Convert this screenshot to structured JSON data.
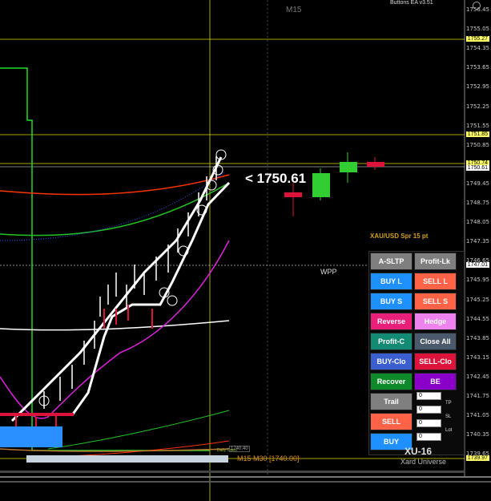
{
  "header": {
    "ea_title": "Buttons EA  v3.51",
    "timeframe": "M15"
  },
  "price_axis": {
    "labels": [
      "1756.45",
      "1755.05",
      "1754.35",
      "1753.65",
      "1752.95",
      "1752.25",
      "1751.55",
      "1750.85",
      "1750.15",
      "1749.45",
      "1748.75",
      "1748.05",
      "1747.35",
      "1746.65",
      "1745.95",
      "1745.25",
      "1744.55",
      "1743.85",
      "1743.15",
      "1742.45",
      "1741.75",
      "1741.05",
      "1740.35",
      "1739.65"
    ],
    "highlight_levels": [
      {
        "label": "1755.27",
        "color": "#ffff66"
      },
      {
        "label": "1751.85",
        "color": "#ffff66"
      },
      {
        "label": "1750.74",
        "color": "#ffff66"
      },
      {
        "label": "1750.61",
        "color": "#ffffff"
      },
      {
        "label": "1747.01",
        "color": "#ffffff"
      },
      {
        "label": "1739.97",
        "color": "#ffff66"
      }
    ]
  },
  "overlay": {
    "current_price": "<  1750.61",
    "symbol_spread": "XAU/USD Spr 15 pt",
    "wpp_label": "WPP",
    "period_label": "M15 M30  [1740.00]",
    "daily_label": "Daily Open",
    "low_box": "1740.40"
  },
  "panel": {
    "buttons": [
      {
        "label": "A-SLTP",
        "color": "#7f7f7f"
      },
      {
        "label": "Profit-Lk",
        "color": "#7f7f7f"
      },
      {
        "label": "BUY L",
        "color": "#1e90ff"
      },
      {
        "label": "SELL L",
        "color": "#ff6347"
      },
      {
        "label": "BUY S",
        "color": "#1e90ff"
      },
      {
        "label": "SELL S",
        "color": "#ff6347"
      },
      {
        "label": "Reverse",
        "color": "#e8207a"
      },
      {
        "label": "Hedge",
        "color": "#ee82ee"
      },
      {
        "label": "Profit-C",
        "color": "#138a73"
      },
      {
        "label": "Close All",
        "color": "#4a5a6a"
      },
      {
        "label": "BUY-Clo",
        "color": "#3b5fcf"
      },
      {
        "label": "SELL-Clo",
        "color": "#dc143c"
      },
      {
        "label": "Recover",
        "color": "#0f8a2a"
      },
      {
        "label": "BE",
        "color": "#8b00c8"
      },
      {
        "label": "Trail",
        "color": "#7f7f7f"
      },
      {
        "label": "SELL",
        "color": "#ff6347"
      },
      {
        "label": "BUY",
        "color": "#1e90ff"
      }
    ],
    "inputs": [
      {
        "value": "0",
        "label": ""
      },
      {
        "value": "0",
        "label": "TP"
      },
      {
        "value": "0",
        "label": "SL"
      },
      {
        "value": "0",
        "label": "Lot"
      }
    ]
  },
  "branding": {
    "xu": "XU-16",
    "xard": "Xard Universe"
  },
  "colors": {
    "background": "#000000",
    "bull": "#32cd32",
    "bear": "#dc143c",
    "ema_green": "#22c522",
    "ema_red": "#ff3300",
    "magenta": "#e020e0",
    "grid": "#ffff66"
  }
}
